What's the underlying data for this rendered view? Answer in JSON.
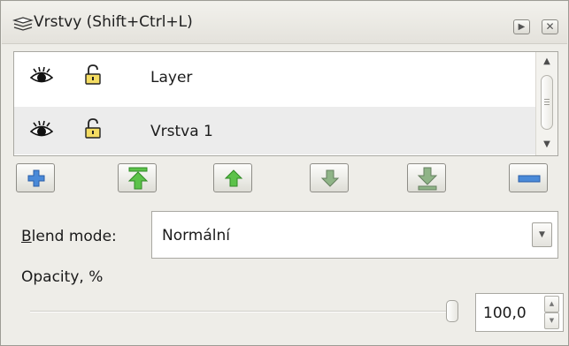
{
  "title": "Vrstvy (Shift+Ctrl+L)",
  "title_buttons": {
    "dock": "▶",
    "close": "✕"
  },
  "layers": [
    {
      "name": "Layer",
      "visible": true,
      "locked": false
    },
    {
      "name": "Vrstva 1",
      "visible": true,
      "locked": false
    }
  ],
  "actions": [
    {
      "id": "add",
      "icon": "plus-icon"
    },
    {
      "id": "raise-to-top",
      "icon": "raise-to-top-icon"
    },
    {
      "id": "raise",
      "icon": "arrow-up-icon"
    },
    {
      "id": "lower",
      "icon": "arrow-down-icon"
    },
    {
      "id": "lower-to-bottom",
      "icon": "lower-to-bottom-icon"
    },
    {
      "id": "remove",
      "icon": "minus-icon"
    }
  ],
  "blend": {
    "mnemonic": "B",
    "label_rest": "lend mode:",
    "value": "Normální",
    "arrow": "▼"
  },
  "opacity": {
    "label": "Opacity, %",
    "value": "100,0",
    "level_percent": 100,
    "spin_up": "▲",
    "spin_down": "▼"
  },
  "scrollbar": {
    "up": "▲",
    "down": "▼"
  },
  "colors": {
    "panel_bg": "#eeede8",
    "selected_row": "#ececec",
    "action_blue": "#3f7fd0",
    "action_green": "#5cc24a"
  }
}
